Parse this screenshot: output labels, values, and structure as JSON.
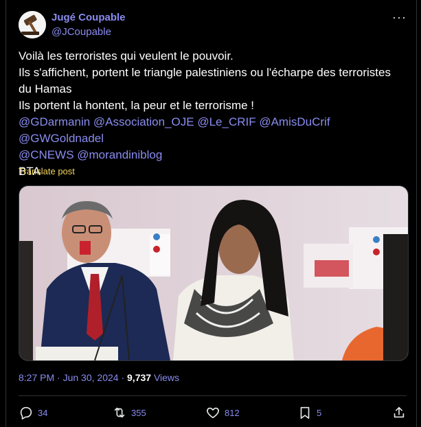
{
  "tweet": {
    "display_name": "Jugé Coupable",
    "handle": "@JCoupable",
    "more_icon": "more-dots-icon",
    "lines": [
      "Voilà les terroristes qui veulent le pouvoir.",
      "Ils s'affichent, portent le triangle palestiniens ou l'écharpe des terroristes",
      "du Hamas",
      "Ils portent la hontent, la peur et le terrorisme !"
    ],
    "mentions_line1": "@GDarmanin @Association_OJE @Le_CRIF @AmisDuCrif @GWGoldnadel",
    "mentions_line2": "@CNEWS @morandiniblog",
    "tail": "BTA",
    "translate_label": "Translate post",
    "time": "8:27 PM",
    "date": "Jun 30, 2024",
    "views_count": "9,737",
    "views_label": "Views"
  },
  "actions": {
    "replies": "34",
    "reposts": "355",
    "likes": "812",
    "bookmarks": "5"
  },
  "colors": {
    "background": "#000000",
    "link": "#8a8cf0",
    "translate": "#f4d65a",
    "border": "#2f3336"
  }
}
